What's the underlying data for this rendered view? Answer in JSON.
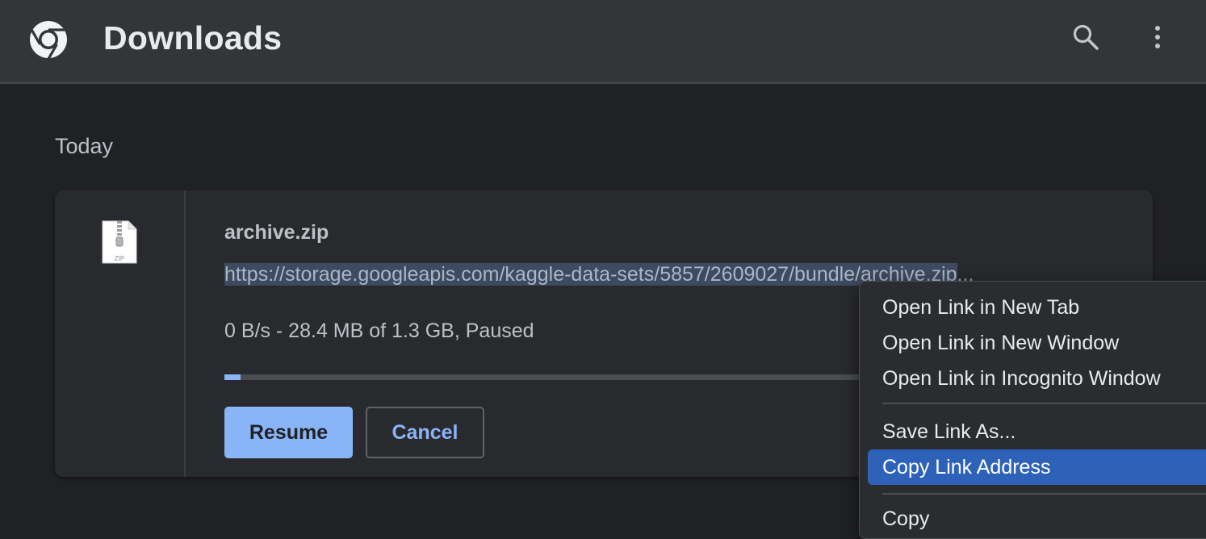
{
  "header": {
    "title": "Downloads",
    "logo_icon": "chrome-logo-icon",
    "search_icon": "search-icon",
    "more_icon": "more-vert-icon"
  },
  "section": {
    "heading": "Today"
  },
  "download": {
    "file_name": "archive.zip",
    "file_type_label": "ZIP",
    "url": "https://storage.googleapis.com/kaggle-data-sets/5857/2609027/bundle/archive.zip",
    "url_ellipsis": "...",
    "status": "0 B/s - 28.4 MB of 1.3 GB, Paused",
    "progress_fraction": 0.018,
    "resume_label": "Resume",
    "cancel_label": "Cancel"
  },
  "context_menu": {
    "items": [
      "Open Link in New Tab",
      "Open Link in New Window",
      "Open Link in Incognito Window",
      "Save Link As...",
      "Copy Link Address",
      "Copy"
    ],
    "highlighted_item": "Copy Link Address"
  },
  "colors": {
    "background": "#202124",
    "topbar": "#323639",
    "card": "#292a2d",
    "accent": "#8ab4f8",
    "menu_highlight": "#2e62b8"
  }
}
